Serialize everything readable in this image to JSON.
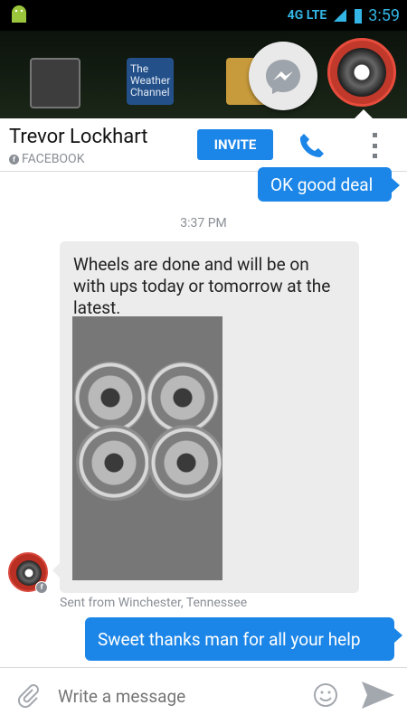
{
  "status": {
    "network": "4G LTE",
    "time": "3:59"
  },
  "home": {
    "weather_line1": "The",
    "weather_line2": "Weather",
    "weather_line3": "Channel"
  },
  "header": {
    "name": "Trevor Lockhart",
    "subtitle": "FACEBOOK",
    "invite": "INVITE"
  },
  "messages": {
    "out1": "OK good deal",
    "time": "3:37 PM",
    "in1": "Wheels are done and will be on with ups today or tomorrow at the latest.",
    "location": "Sent from Winchester, Tennessee",
    "out2": "Sweet thanks man for all your help"
  },
  "composer": {
    "placeholder": "Write a message"
  }
}
